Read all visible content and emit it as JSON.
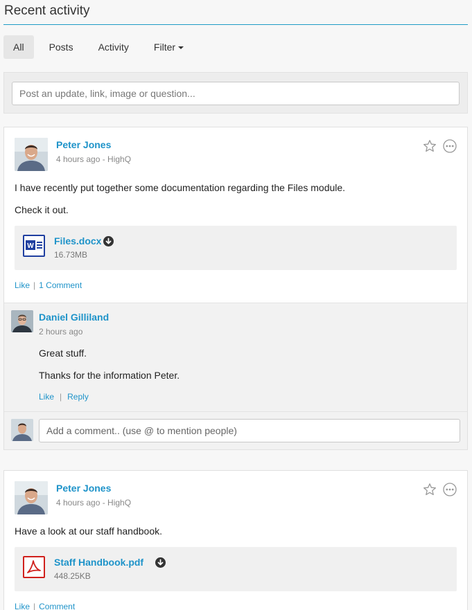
{
  "header": {
    "title": "Recent activity"
  },
  "tabs": [
    {
      "label": "All"
    },
    {
      "label": "Posts"
    },
    {
      "label": "Activity"
    },
    {
      "label": "Filter"
    }
  ],
  "composer": {
    "placeholder": "Post an update, link, image or question..."
  },
  "colors": {
    "accent": "#1e93c9",
    "rule": "#1e9bc5"
  },
  "posts": [
    {
      "author": "Peter Jones",
      "meta": "4 hours ago - HighQ",
      "lines": [
        "I have recently put together some documentation regarding the Files module.",
        "Check it out."
      ],
      "attachment": {
        "name": "Files.docx",
        "size": "16.73MB",
        "icon": "word-doc-icon"
      },
      "actions": {
        "like": "Like",
        "comment": "1 Comment"
      },
      "comments": [
        {
          "author": "Daniel Gilliland",
          "meta": "2 hours ago",
          "lines": [
            "Great stuff.",
            "Thanks for the information Peter."
          ],
          "actions": {
            "like": "Like",
            "reply": "Reply"
          }
        }
      ],
      "comment_placeholder": "Add a comment.. (use @ to mention people)"
    },
    {
      "author": "Peter Jones",
      "meta": "4 hours ago - HighQ",
      "lines": [
        "Have a look at our staff handbook."
      ],
      "attachment": {
        "name": "Staff Handbook.pdf",
        "size": "448.25KB",
        "icon": "pdf-icon"
      },
      "actions": {
        "like": "Like",
        "comment": "Comment"
      }
    }
  ]
}
